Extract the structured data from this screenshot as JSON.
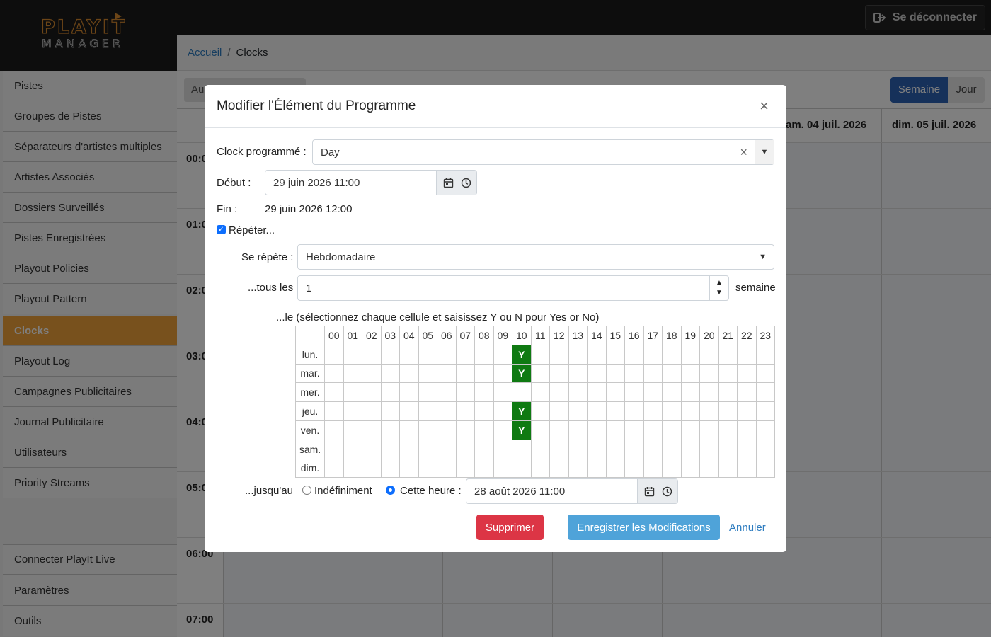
{
  "header": {
    "logo_line1": "PLAYIT",
    "logo_line2": "MANAGER",
    "logout_label": "Se déconnecter"
  },
  "breadcrumb": {
    "home": "Accueil",
    "current": "Clocks"
  },
  "sidebar": {
    "items": [
      {
        "label": "Pistes"
      },
      {
        "label": "Groupes de Pistes"
      },
      {
        "label": "Séparateurs d'artistes multiples"
      },
      {
        "label": "Artistes Associés"
      },
      {
        "label": "Dossiers Surveillés"
      },
      {
        "label": "Pistes Enregistrées"
      },
      {
        "label": "Playout Policies"
      },
      {
        "label": "Playout Pattern"
      },
      {
        "label": "Clocks",
        "active": true
      },
      {
        "label": "Playout Log"
      },
      {
        "label": "Campagnes Publicitaires"
      },
      {
        "label": "Journal Publicitaire"
      },
      {
        "label": "Utilisateurs"
      },
      {
        "label": "Priority Streams"
      }
    ],
    "bottom_items": [
      {
        "label": "Connecter PlayIt Live"
      },
      {
        "label": "Paramètres"
      },
      {
        "label": "Outils"
      }
    ]
  },
  "calendar": {
    "today_partial": "Au",
    "view_week": "Semaine",
    "view_day": "Jour",
    "day_headers": [
      "am. 04 juil. 2026",
      "dim. 05 juil. 2026"
    ],
    "time_partials": [
      "00:0",
      "01:0",
      "02:0",
      "03:0",
      "04:0",
      "05:0",
      "06:00",
      "07:00"
    ]
  },
  "modal": {
    "title": "Modifier l'Élément du Programme",
    "close_glyph": "×",
    "clock_label": "Clock programmé :",
    "clock_value": "Day",
    "clear_glyph": "×",
    "start_label": "Début :",
    "start_value": "29 juin 2026 11:00",
    "end_label": "Fin :",
    "end_value": "29 juin 2026 12:00",
    "repeat_label": "Répéter...",
    "repeat_checked": true,
    "repeats_label": "Se répète :",
    "repeats_value": "Hebdomadaire",
    "every_label": "...tous les",
    "every_value": "1",
    "every_unit": "semaine",
    "on_label": "...le (sélectionnez chaque cellule et saisissez Y ou N pour Yes or No)",
    "hours": [
      "00",
      "01",
      "02",
      "03",
      "04",
      "05",
      "06",
      "07",
      "08",
      "09",
      "10",
      "11",
      "12",
      "13",
      "14",
      "15",
      "16",
      "17",
      "18",
      "19",
      "20",
      "21",
      "22",
      "23"
    ],
    "days": [
      {
        "name": "lun.",
        "cells": {
          "10": "Y"
        }
      },
      {
        "name": "mar.",
        "cells": {
          "10": "Y"
        }
      },
      {
        "name": "mer.",
        "cells": {}
      },
      {
        "name": "jeu.",
        "cells": {
          "10": "Y"
        }
      },
      {
        "name": "ven.",
        "cells": {
          "10": "Y"
        }
      },
      {
        "name": "sam.",
        "cells": {}
      },
      {
        "name": "dim.",
        "cells": {}
      }
    ],
    "until_label": "...jusqu'au",
    "until_indef_label": "Indéfiniment",
    "until_this_label": "Cette heure :",
    "until_selected": "this_time",
    "until_value": "28 août 2026 11:00",
    "delete_label": "Supprimer",
    "save_label": "Enregistrer les Modifications",
    "cancel_label": "Annuler"
  },
  "colors": {
    "accent": "#f0a23a",
    "primary": "#2c62b5",
    "danger": "#dc3545",
    "yes_cell": "#0f7a12"
  }
}
